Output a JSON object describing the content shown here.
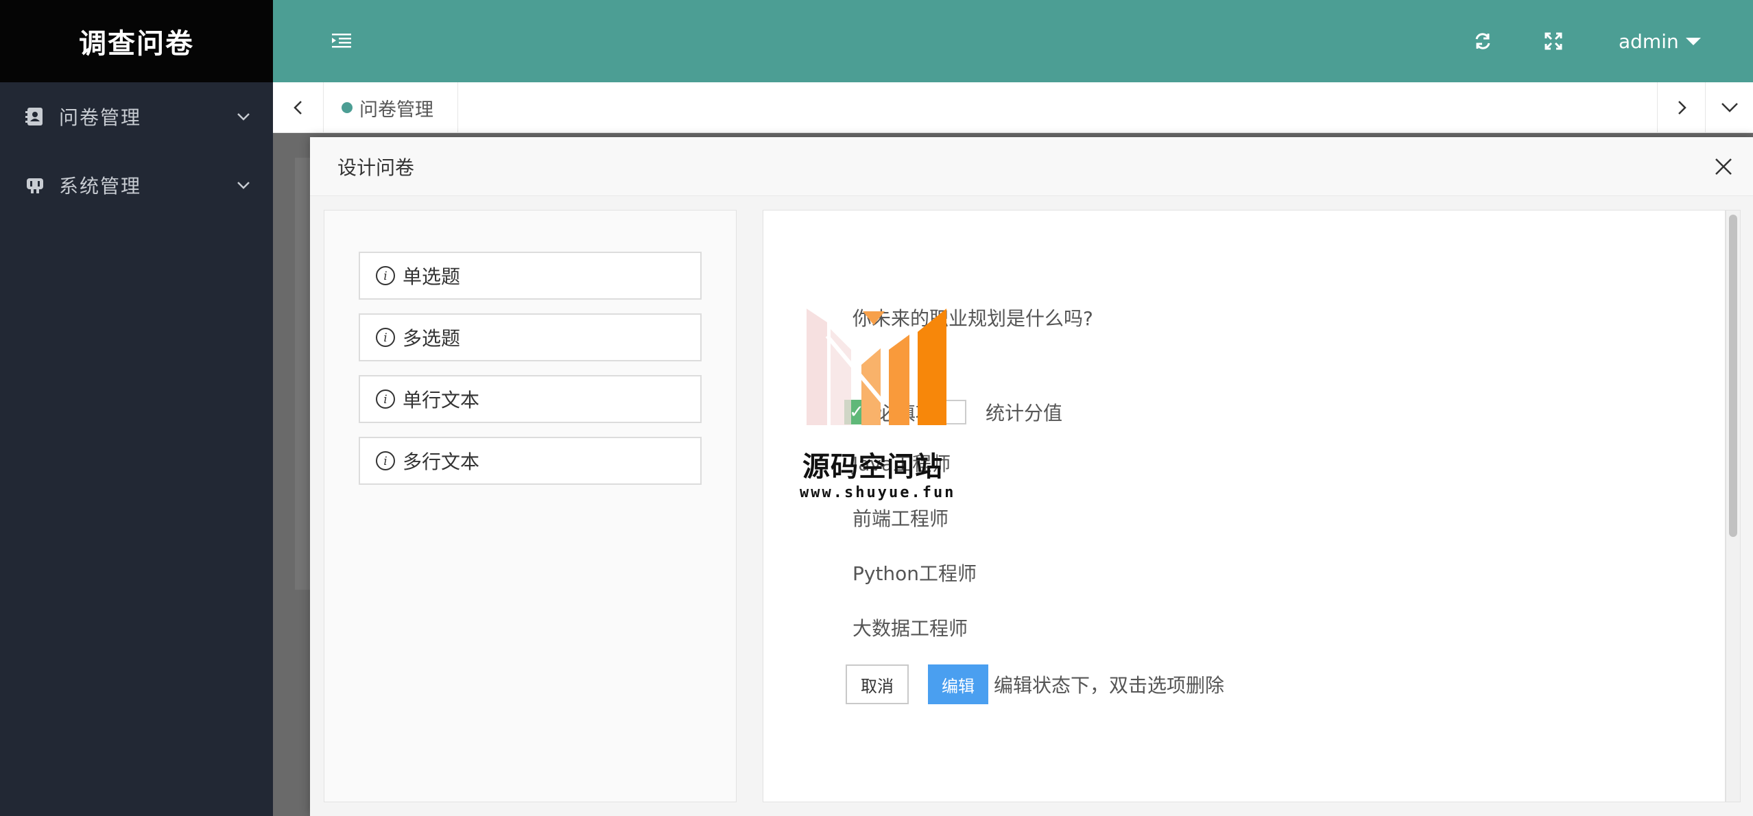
{
  "sidebar": {
    "brand": "调查问卷",
    "items": [
      {
        "label": "问卷管理",
        "icon": "address-book-icon"
      },
      {
        "label": "系统管理",
        "icon": "gamepad-icon"
      }
    ]
  },
  "header": {
    "user": "admin",
    "icons": [
      "menu-indent-icon",
      "refresh-icon",
      "fullscreen-icon"
    ]
  },
  "tabs": [
    {
      "label": "问卷管理",
      "active": true
    }
  ],
  "modal": {
    "title": "设计问卷",
    "question_types": [
      "单选题",
      "多选题",
      "单行文本",
      "多行文本"
    ],
    "editor": {
      "question": "你未来的职业规划是什么吗?",
      "required_label": "必填项",
      "required_checked": true,
      "stat_label": "统计分值",
      "stat_checked": false,
      "options": [
        "Java工程师",
        "前端工程师",
        "Python工程师",
        "大数据工程师"
      ],
      "cancel_label": "取消",
      "edit_label": "编辑",
      "hint": "编辑状态下，双击选项删除"
    }
  },
  "watermark": {
    "title": "源码空间站",
    "url": "www.shuyue.fun"
  },
  "colors": {
    "header": "#4c9e94",
    "sidebar": "#222834",
    "brand_bg": "#050505",
    "edit_button": "#4a9ff0",
    "checked": "#5fb878"
  }
}
